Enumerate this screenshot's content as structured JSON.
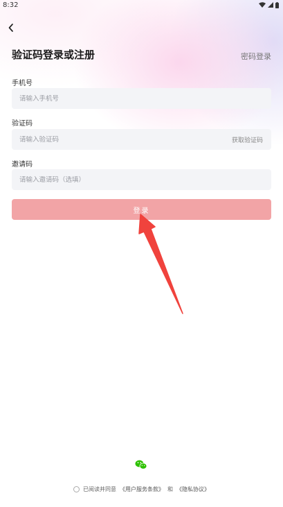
{
  "status_bar": {
    "time": "8:32"
  },
  "header": {
    "title": "验证码登录或注册",
    "password_login": "密码登录"
  },
  "form": {
    "phone": {
      "label": "手机号",
      "placeholder": "请输入手机号"
    },
    "code": {
      "label": "验证码",
      "placeholder": "请输入验证码",
      "get_code": "获取验证码"
    },
    "invite": {
      "label": "邀请码",
      "placeholder": "请输入邀请码（选填）"
    },
    "login_label": "登录"
  },
  "agreement": {
    "prefix": "已阅读并同意",
    "user_terms": "《用户服务条款》",
    "and": "和",
    "privacy": "《隐私协议》"
  },
  "colors": {
    "login_button": "#f2a4a6",
    "arrow": "#f0433d",
    "wechat": "#2dc100",
    "field_bg": "#f3f4f7"
  },
  "icons": {
    "back": "chevron-left-icon",
    "wechat": "wechat-icon",
    "wifi": "wifi-icon",
    "signal": "signal-icon",
    "battery": "battery-icon"
  }
}
